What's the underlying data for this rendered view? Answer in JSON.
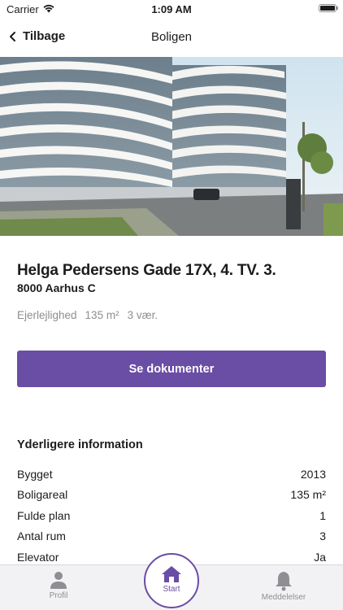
{
  "status": {
    "carrier": "Carrier",
    "time": "1:09 AM"
  },
  "nav": {
    "back_label": "Tilbage",
    "title": "Boligen"
  },
  "property": {
    "address": "Helga Pedersens Gade 17X, 4. TV. 3.",
    "postal": "8000 Aarhus C",
    "type": "Ejerlejlighed",
    "area": "135 m²",
    "rooms": "3 vær."
  },
  "actions": {
    "documents_label": "Se dokumenter"
  },
  "info": {
    "heading": "Yderligere information",
    "rows": [
      {
        "label": "Bygget",
        "value": "2013"
      },
      {
        "label": "Boligareal",
        "value": "135 m²"
      },
      {
        "label": "Fulde plan",
        "value": "1"
      },
      {
        "label": "Antal rum",
        "value": "3"
      },
      {
        "label": "Elevator",
        "value": "Ja"
      }
    ]
  },
  "tabs": {
    "profile": "Profil",
    "start": "Start",
    "messages": "Meddelelser"
  },
  "colors": {
    "accent": "#6a4da4",
    "muted": "#8e8e93",
    "text": "#1c1c1e"
  }
}
